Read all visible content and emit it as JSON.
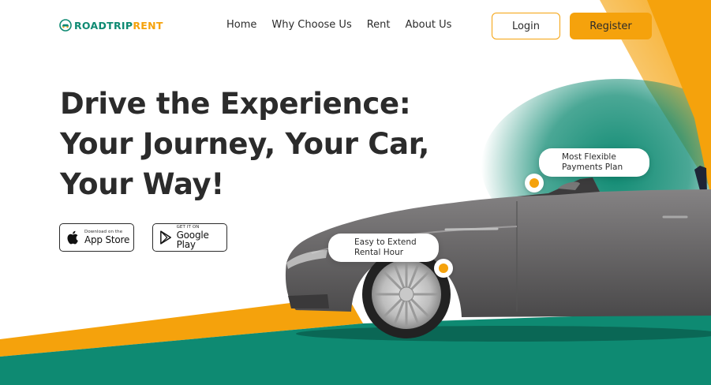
{
  "brand": {
    "logo_part1": "ROADTRIP",
    "logo_part2": "RENT",
    "icon": "car-logo-icon"
  },
  "nav": {
    "links": [
      "Home",
      "Why Choose Us",
      "Rent",
      "About Us"
    ],
    "login_label": "Login",
    "register_label": "Register"
  },
  "hero": {
    "title_lines": [
      "Drive the Experience:",
      "Your Journey, Your Car,",
      "Your Way!"
    ]
  },
  "stores": {
    "app_store": {
      "small": "Download on the",
      "big": "App Store",
      "icon": "apple-icon"
    },
    "google_play": {
      "small": "GET IT ON",
      "big": "Google Play",
      "icon": "play-store-icon"
    }
  },
  "callouts": {
    "flexible": [
      "Most Flexible",
      "Payments Plan"
    ],
    "extend": [
      "Easy to Extend",
      "Rental Hour"
    ]
  },
  "colors": {
    "accent_orange": "#f5a20c",
    "accent_green": "#0e8a72",
    "text_dark": "#2b2b2b",
    "car_body": "#6d6b6c"
  }
}
